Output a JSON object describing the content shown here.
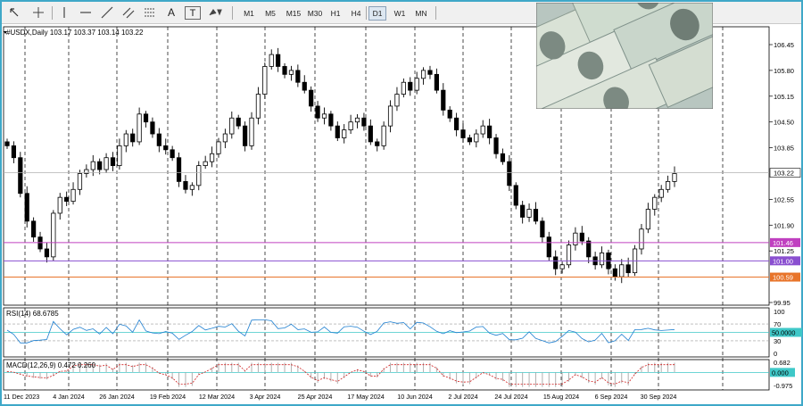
{
  "toolbar": {
    "timeframes": [
      "M1",
      "M5",
      "M15",
      "M30",
      "H1",
      "H4",
      "D1",
      "W1",
      "MN"
    ],
    "active_timeframe": "D1",
    "tools": [
      "crosshair-icon",
      "cursor-cross-icon",
      "vertical-line-icon",
      "horizontal-line-icon",
      "trendline-icon",
      "equidistant-channel-icon",
      "fibonacci-icon",
      "text-icon",
      "text-label-icon",
      "arrows-icon"
    ],
    "text_tool_label": "A",
    "label_tool_label": "T"
  },
  "main": {
    "header": "#USDX,Daily  103.17 103.37 103.14 103.22",
    "price_labels": [
      "106.45",
      "105.80",
      "105.15",
      "104.50",
      "103.85",
      "103.22",
      "102.55",
      "101.90",
      "101.46",
      "101.25",
      "101.00",
      "100.59",
      "99.95"
    ],
    "current_price": "103.22",
    "levels": [
      {
        "price": "101.46",
        "color": "#c040c0"
      },
      {
        "price": "101.00",
        "color": "#8a4fd0"
      },
      {
        "price": "100.59",
        "color": "#e8742a"
      }
    ]
  },
  "rsi": {
    "header": "RSI(14) 68.6785",
    "scale": [
      "100",
      "70",
      "50.0000",
      "30",
      "0"
    ],
    "value_label": "50.0000"
  },
  "macd": {
    "header": "MACD(12,26,9) 0.472 0.260",
    "scale": [
      "0.682",
      "0.000",
      "-0.975"
    ],
    "zero_label": "0.000"
  },
  "dates": [
    "11 Dec 2023",
    "4 Jan 2024",
    "26 Jan 2024",
    "19 Feb 2024",
    "12 Mar 2024",
    "3 Apr 2024",
    "25 Apr 2024",
    "17 May 2024",
    "10 Jun 2024",
    "2 Jul 2024",
    "24 Jul 2024",
    "15 Aug 2024",
    "6 Sep 2024",
    "30 Sep 2024"
  ],
  "chart_data": {
    "type": "candlestick",
    "symbol": "#USDX",
    "timeframe": "Daily",
    "ohlc_last": {
      "open": 103.17,
      "high": 103.37,
      "low": 103.14,
      "close": 103.22
    },
    "ylim": [
      99.95,
      106.45
    ],
    "x_dates": [
      "11 Dec 2023",
      "4 Jan 2024",
      "26 Jan 2024",
      "19 Feb 2024",
      "12 Mar 2024",
      "3 Apr 2024",
      "25 Apr 2024",
      "17 May 2024",
      "10 Jun 2024",
      "2 Jul 2024",
      "24 Jul 2024",
      "15 Aug 2024",
      "6 Sep 2024",
      "30 Sep 2024"
    ],
    "closes": [
      103.9,
      103.6,
      102.7,
      102.0,
      101.6,
      101.3,
      101.1,
      102.2,
      102.6,
      102.5,
      102.8,
      103.2,
      103.3,
      103.5,
      103.3,
      103.6,
      103.4,
      103.9,
      104.2,
      104.0,
      104.7,
      104.5,
      104.2,
      103.9,
      103.8,
      103.6,
      103.0,
      102.8,
      102.9,
      103.4,
      103.5,
      103.7,
      104.0,
      104.2,
      104.6,
      104.4,
      103.9,
      104.6,
      105.2,
      105.9,
      106.2,
      105.9,
      105.7,
      105.8,
      105.5,
      105.3,
      104.9,
      104.6,
      104.7,
      104.4,
      104.1,
      104.3,
      104.5,
      104.6,
      104.4,
      104.0,
      103.9,
      104.4,
      104.9,
      105.2,
      105.5,
      105.3,
      105.6,
      105.8,
      105.7,
      105.3,
      104.8,
      104.6,
      104.3,
      104.1,
      104.0,
      104.2,
      104.4,
      104.1,
      103.7,
      103.5,
      102.9,
      102.4,
      102.1,
      102.3,
      102.0,
      101.6,
      101.1,
      100.8,
      100.9,
      101.4,
      101.7,
      101.5,
      101.1,
      100.9,
      101.2,
      100.8,
      100.6,
      100.9,
      100.7,
      101.3,
      101.8,
      102.3,
      102.6,
      102.8,
      103.0,
      103.2
    ],
    "horizontal_levels": [
      101.46,
      101.0,
      100.59
    ],
    "rsi": {
      "period": 14,
      "value": 68.6785,
      "levels": [
        70,
        50,
        30
      ],
      "ylim": [
        0,
        100
      ]
    },
    "macd": {
      "fast": 12,
      "slow": 26,
      "signal": 9,
      "macd": 0.472,
      "signal_value": 0.26,
      "ylim": [
        -0.975,
        0.682
      ]
    }
  }
}
